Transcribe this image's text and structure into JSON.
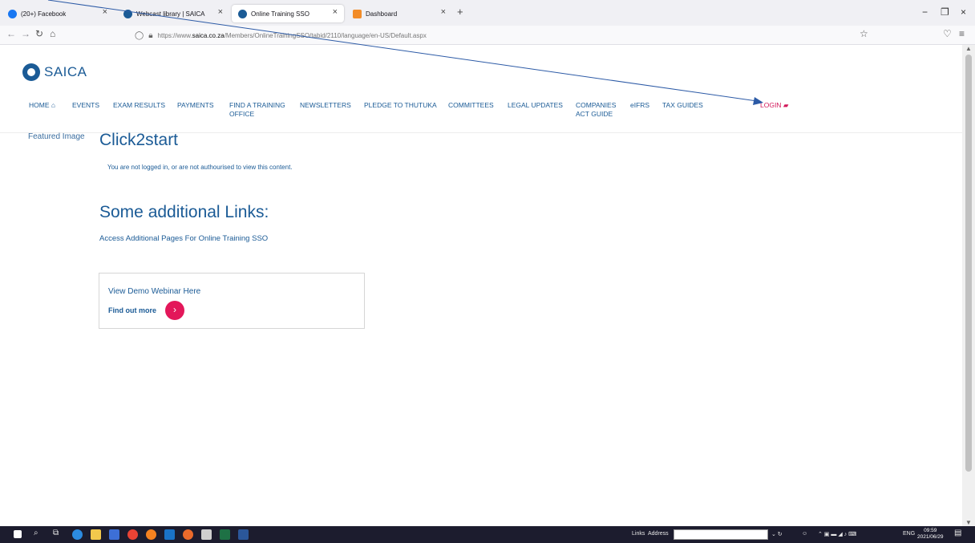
{
  "browser": {
    "tabs": [
      {
        "title": "(20+) Facebook",
        "color": "#1877f2"
      },
      {
        "title": "Webcast library | SAICA",
        "color": "#1b5b96"
      },
      {
        "title": "Online Training SSO",
        "color": "#1b5b96"
      },
      {
        "title": "Dashboard",
        "color": "#f28c28"
      }
    ],
    "url_prefix": "https://www.",
    "url_domain": "saica.co.za",
    "url_rest": "/Members/OnlineTrainingSSO/tabid/2110/language/en-US/Default.aspx"
  },
  "site": {
    "logo_text": "SAICA",
    "menu": [
      {
        "label": "HOME"
      },
      {
        "label": "EVENTS"
      },
      {
        "label": "EXAM RESULTS"
      },
      {
        "label": "PAYMENTS"
      },
      {
        "label": "FIND A TRAINING OFFICE"
      },
      {
        "label": "NEWSLETTERS"
      },
      {
        "label": "PLEDGE TO THUTUKA"
      },
      {
        "label": "COMMITTEES"
      },
      {
        "label": "LEGAL UPDATES"
      },
      {
        "label": "COMPANIES ACT GUIDE"
      },
      {
        "label": "eIFRS"
      },
      {
        "label": "TAX GUIDES"
      }
    ],
    "login_label": "LOGIN",
    "accent": "#d2185a",
    "brand_color": "#1b5b96"
  },
  "content": {
    "featured_image_alt": "Featured Image",
    "title": "Click2start",
    "notice": "You are not logged in, or are not authourised to view this content.",
    "links_heading": "Some additional Links:",
    "access_link": "Access Additional Pages For Online Training SSO",
    "card": {
      "title": "View Demo Webinar Here",
      "more": "Find out more"
    }
  },
  "taskbar": {
    "links_label": "Links",
    "address_label": "Address",
    "lang": "ENG",
    "time": "09:59",
    "date": "2021/06/29"
  }
}
